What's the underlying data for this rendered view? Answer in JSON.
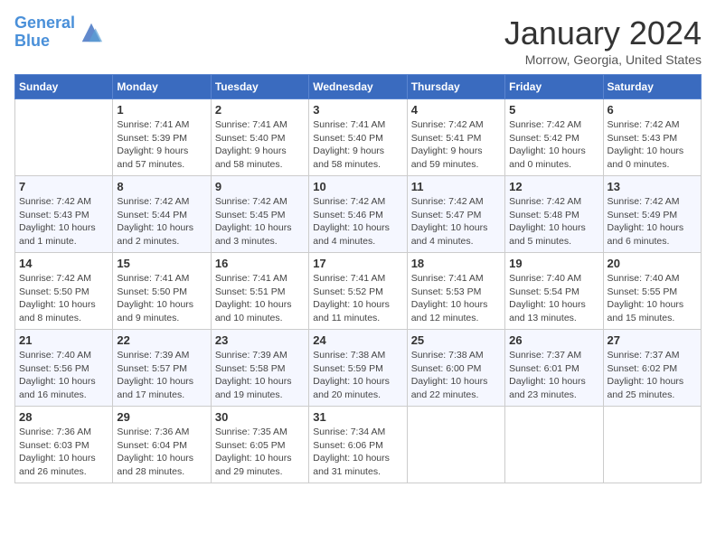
{
  "logo": {
    "line1": "General",
    "line2": "Blue"
  },
  "title": "January 2024",
  "location": "Morrow, Georgia, United States",
  "days_header": [
    "Sunday",
    "Monday",
    "Tuesday",
    "Wednesday",
    "Thursday",
    "Friday",
    "Saturday"
  ],
  "weeks": [
    [
      {
        "day": "",
        "info": ""
      },
      {
        "day": "1",
        "info": "Sunrise: 7:41 AM\nSunset: 5:39 PM\nDaylight: 9 hours\nand 57 minutes."
      },
      {
        "day": "2",
        "info": "Sunrise: 7:41 AM\nSunset: 5:40 PM\nDaylight: 9 hours\nand 58 minutes."
      },
      {
        "day": "3",
        "info": "Sunrise: 7:41 AM\nSunset: 5:40 PM\nDaylight: 9 hours\nand 58 minutes."
      },
      {
        "day": "4",
        "info": "Sunrise: 7:42 AM\nSunset: 5:41 PM\nDaylight: 9 hours\nand 59 minutes."
      },
      {
        "day": "5",
        "info": "Sunrise: 7:42 AM\nSunset: 5:42 PM\nDaylight: 10 hours\nand 0 minutes."
      },
      {
        "day": "6",
        "info": "Sunrise: 7:42 AM\nSunset: 5:43 PM\nDaylight: 10 hours\nand 0 minutes."
      }
    ],
    [
      {
        "day": "7",
        "info": "Sunrise: 7:42 AM\nSunset: 5:43 PM\nDaylight: 10 hours\nand 1 minute."
      },
      {
        "day": "8",
        "info": "Sunrise: 7:42 AM\nSunset: 5:44 PM\nDaylight: 10 hours\nand 2 minutes."
      },
      {
        "day": "9",
        "info": "Sunrise: 7:42 AM\nSunset: 5:45 PM\nDaylight: 10 hours\nand 3 minutes."
      },
      {
        "day": "10",
        "info": "Sunrise: 7:42 AM\nSunset: 5:46 PM\nDaylight: 10 hours\nand 4 minutes."
      },
      {
        "day": "11",
        "info": "Sunrise: 7:42 AM\nSunset: 5:47 PM\nDaylight: 10 hours\nand 4 minutes."
      },
      {
        "day": "12",
        "info": "Sunrise: 7:42 AM\nSunset: 5:48 PM\nDaylight: 10 hours\nand 5 minutes."
      },
      {
        "day": "13",
        "info": "Sunrise: 7:42 AM\nSunset: 5:49 PM\nDaylight: 10 hours\nand 6 minutes."
      }
    ],
    [
      {
        "day": "14",
        "info": "Sunrise: 7:42 AM\nSunset: 5:50 PM\nDaylight: 10 hours\nand 8 minutes."
      },
      {
        "day": "15",
        "info": "Sunrise: 7:41 AM\nSunset: 5:50 PM\nDaylight: 10 hours\nand 9 minutes."
      },
      {
        "day": "16",
        "info": "Sunrise: 7:41 AM\nSunset: 5:51 PM\nDaylight: 10 hours\nand 10 minutes."
      },
      {
        "day": "17",
        "info": "Sunrise: 7:41 AM\nSunset: 5:52 PM\nDaylight: 10 hours\nand 11 minutes."
      },
      {
        "day": "18",
        "info": "Sunrise: 7:41 AM\nSunset: 5:53 PM\nDaylight: 10 hours\nand 12 minutes."
      },
      {
        "day": "19",
        "info": "Sunrise: 7:40 AM\nSunset: 5:54 PM\nDaylight: 10 hours\nand 13 minutes."
      },
      {
        "day": "20",
        "info": "Sunrise: 7:40 AM\nSunset: 5:55 PM\nDaylight: 10 hours\nand 15 minutes."
      }
    ],
    [
      {
        "day": "21",
        "info": "Sunrise: 7:40 AM\nSunset: 5:56 PM\nDaylight: 10 hours\nand 16 minutes."
      },
      {
        "day": "22",
        "info": "Sunrise: 7:39 AM\nSunset: 5:57 PM\nDaylight: 10 hours\nand 17 minutes."
      },
      {
        "day": "23",
        "info": "Sunrise: 7:39 AM\nSunset: 5:58 PM\nDaylight: 10 hours\nand 19 minutes."
      },
      {
        "day": "24",
        "info": "Sunrise: 7:38 AM\nSunset: 5:59 PM\nDaylight: 10 hours\nand 20 minutes."
      },
      {
        "day": "25",
        "info": "Sunrise: 7:38 AM\nSunset: 6:00 PM\nDaylight: 10 hours\nand 22 minutes."
      },
      {
        "day": "26",
        "info": "Sunrise: 7:37 AM\nSunset: 6:01 PM\nDaylight: 10 hours\nand 23 minutes."
      },
      {
        "day": "27",
        "info": "Sunrise: 7:37 AM\nSunset: 6:02 PM\nDaylight: 10 hours\nand 25 minutes."
      }
    ],
    [
      {
        "day": "28",
        "info": "Sunrise: 7:36 AM\nSunset: 6:03 PM\nDaylight: 10 hours\nand 26 minutes."
      },
      {
        "day": "29",
        "info": "Sunrise: 7:36 AM\nSunset: 6:04 PM\nDaylight: 10 hours\nand 28 minutes."
      },
      {
        "day": "30",
        "info": "Sunrise: 7:35 AM\nSunset: 6:05 PM\nDaylight: 10 hours\nand 29 minutes."
      },
      {
        "day": "31",
        "info": "Sunrise: 7:34 AM\nSunset: 6:06 PM\nDaylight: 10 hours\nand 31 minutes."
      },
      {
        "day": "",
        "info": ""
      },
      {
        "day": "",
        "info": ""
      },
      {
        "day": "",
        "info": ""
      }
    ]
  ]
}
